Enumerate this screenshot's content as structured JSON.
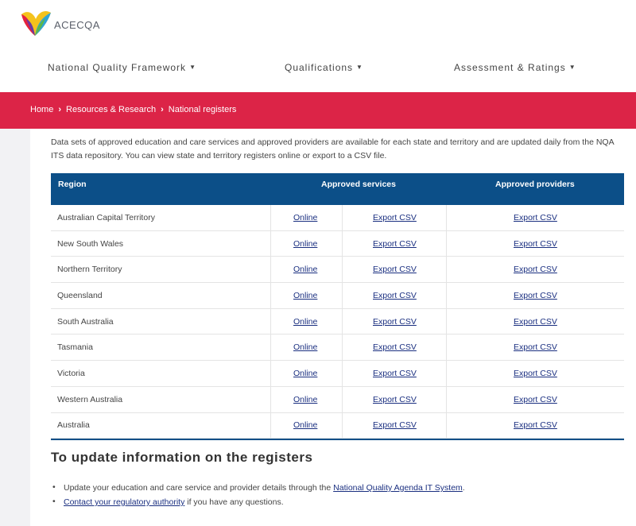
{
  "logo": {
    "text": "ACECQA"
  },
  "nav": [
    {
      "label": "National Quality Framework"
    },
    {
      "label": "Qualifications"
    },
    {
      "label": "Assessment & Ratings"
    }
  ],
  "breadcrumb": {
    "home": "Home",
    "section": "Resources & Research",
    "current": "National registers"
  },
  "intro": "Data sets of approved education and care services and approved providers are available for each state and territory and are updated daily from the NQA ITS data repository. You can view state and territory registers online or export to a CSV file.",
  "table": {
    "headers": {
      "region": "Region",
      "services": "Approved services",
      "providers": "Approved providers"
    },
    "rows": [
      {
        "region": "Australian Capital Territory",
        "online": "Online",
        "services_csv": "Export CSV",
        "providers_csv": "Export CSV"
      },
      {
        "region": "New South Wales",
        "online": "Online",
        "services_csv": "Export CSV",
        "providers_csv": "Export CSV"
      },
      {
        "region": "Northern Territory",
        "online": "Online",
        "services_csv": "Export CSV",
        "providers_csv": "Export CSV"
      },
      {
        "region": "Queensland",
        "online": "Online",
        "services_csv": "Export CSV",
        "providers_csv": "Export CSV"
      },
      {
        "region": "South Australia",
        "online": "Online",
        "services_csv": "Export CSV",
        "providers_csv": "Export CSV"
      },
      {
        "region": "Tasmania",
        "online": "Online",
        "services_csv": "Export CSV",
        "providers_csv": "Export CSV"
      },
      {
        "region": "Victoria",
        "online": "Online",
        "services_csv": "Export CSV",
        "providers_csv": "Export CSV"
      },
      {
        "region": "Western Australia",
        "online": "Online",
        "services_csv": "Export CSV",
        "providers_csv": "Export CSV"
      },
      {
        "region": "Australia",
        "online": "Online",
        "services_csv": "Export CSV",
        "providers_csv": "Export CSV"
      }
    ]
  },
  "update": {
    "heading": "To update information on the registers",
    "item1_prefix": "Update your education and care service and provider details through the ",
    "item1_link": "National Quality Agenda IT System",
    "item1_suffix": ".",
    "item2_link": "Contact your regulatory authority",
    "item2_suffix": " if you have any questions."
  },
  "colors": {
    "brand_red": "#dc2447",
    "table_header": "#0c4f88",
    "link": "#1a2f80"
  }
}
